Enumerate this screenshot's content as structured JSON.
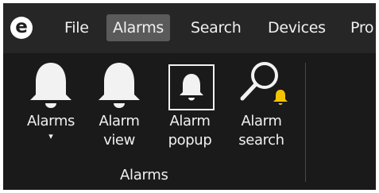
{
  "app": {
    "logo_letter": "e"
  },
  "menu": {
    "items": [
      {
        "label": "File"
      },
      {
        "label": "Alarms"
      },
      {
        "label": "Search"
      },
      {
        "label": "Devices"
      },
      {
        "label": "Pro"
      }
    ],
    "active_index": 1
  },
  "ribbon": {
    "buttons": [
      {
        "label_line1": "Alarms",
        "label_line2": "▾",
        "icon": "bell-icon"
      },
      {
        "label_line1": "Alarm",
        "label_line2": "view",
        "icon": "bell-icon"
      },
      {
        "label_line1": "Alarm",
        "label_line2": "popup",
        "icon": "bell-in-frame-icon"
      },
      {
        "label_line1": "Alarm",
        "label_line2": "search",
        "icon": "magnifier-bell-icon"
      }
    ],
    "group_label": "Alarms"
  },
  "colors": {
    "background": "#1e1e1e",
    "menubar": "#262626",
    "active_menu": "#5a5a5a",
    "icon_white": "#f2f2f2",
    "bell_accent": "#f5c400"
  }
}
